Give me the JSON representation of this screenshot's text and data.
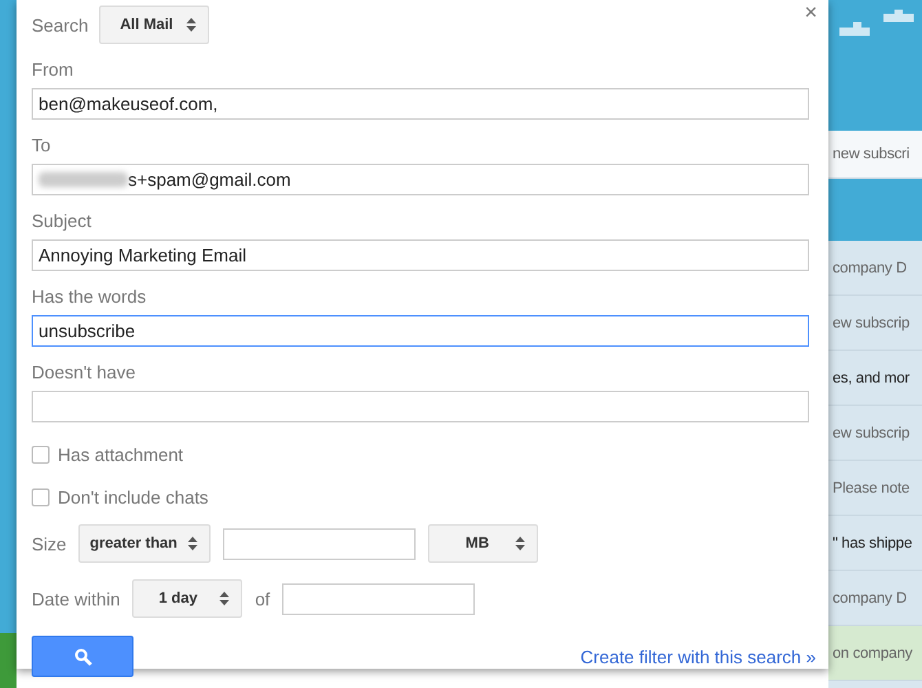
{
  "search": {
    "label": "Search",
    "scope": "All Mail"
  },
  "close": "×",
  "fields": [
    {
      "label": "From",
      "value": "ben@makeuseof.com,",
      "focused": false,
      "redacted": false
    },
    {
      "label": "To",
      "value": "s+spam@gmail.com",
      "focused": false,
      "redacted": true
    },
    {
      "label": "Subject",
      "value": "Annoying Marketing Email",
      "focused": false,
      "redacted": false
    },
    {
      "label": "Has the words",
      "value": "unsubscribe",
      "focused": true,
      "redacted": false
    },
    {
      "label": "Doesn't have",
      "focused": false,
      "redacted": false
    }
  ],
  "checkboxes": [
    {
      "label": "Has attachment",
      "checked": false
    },
    {
      "label": "Don't include chats",
      "checked": false
    }
  ],
  "size": {
    "label": "Size",
    "comparison": "greater than",
    "unit": "MB"
  },
  "date": {
    "label": "Date within",
    "range": "1 day",
    "of": "of"
  },
  "create_filter_link": "Create filter with this search »",
  "background_rows": [
    {
      "text": "new subscri",
      "unread": false,
      "kind": "white"
    },
    {
      "text": "company D",
      "unread": false,
      "kind": "row"
    },
    {
      "text": "ew subscrip",
      "unread": false,
      "kind": "row"
    },
    {
      "text": "es, and mor",
      "unread": true,
      "kind": "row"
    },
    {
      "text": "ew subscrip",
      "unread": false,
      "kind": "row"
    },
    {
      "text": "Please note",
      "unread": false,
      "kind": "row"
    },
    {
      "text": "\" has shippe",
      "unread": true,
      "kind": "row"
    },
    {
      "text": "company D",
      "unread": false,
      "kind": "row"
    },
    {
      "text": "on company",
      "unread": false,
      "kind": "grass"
    }
  ]
}
